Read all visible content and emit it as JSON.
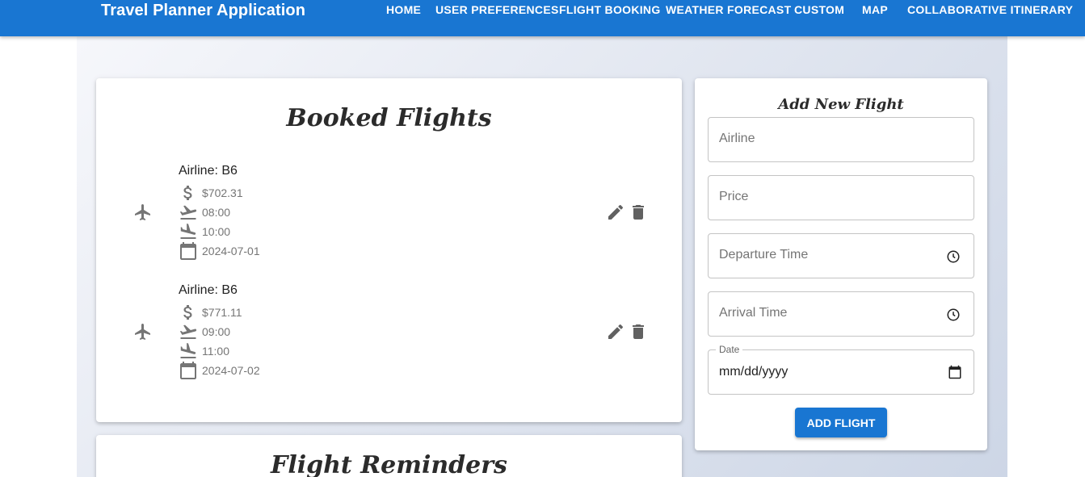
{
  "app": {
    "title": "Travel Planner Application"
  },
  "nav": [
    "HOME",
    "USER PREFERENCES",
    "FLIGHT BOOKING",
    "WEATHER FORECAST",
    "CUSTOM",
    "MAP",
    "COLLABORATIVE ITINERARY"
  ],
  "booked": {
    "title": "Booked Flights",
    "flights": [
      {
        "airline": "Airline: B6",
        "price": "$702.31",
        "departure": "08:00",
        "arrival": "10:00",
        "date": "2024-07-01"
      },
      {
        "airline": "Airline: B6",
        "price": "$771.11",
        "departure": "09:00",
        "arrival": "11:00",
        "date": "2024-07-02"
      }
    ]
  },
  "reminders": {
    "title": "Flight Reminders"
  },
  "form": {
    "title": "Add New Flight",
    "airline_placeholder": "Airline",
    "price_placeholder": "Price",
    "departure_placeholder": "Departure Time",
    "arrival_placeholder": "Arrival Time",
    "date_label": "Date",
    "date_value": "mm/dd/yyyy",
    "submit_label": "ADD FLIGHT"
  },
  "colors": {
    "primary": "#1976d2",
    "icon_grey": "#757575"
  },
  "icons": [
    "flight-icon",
    "dollar-icon",
    "takeoff-icon",
    "landing-icon",
    "calendar-icon",
    "edit-icon",
    "delete-icon",
    "clock-icon"
  ]
}
